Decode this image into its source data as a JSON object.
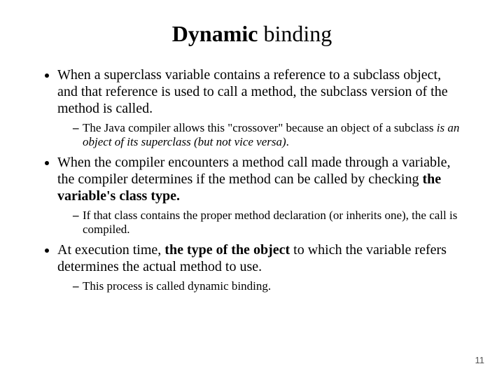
{
  "title": {
    "bold": "Dynamic",
    "rest": " binding"
  },
  "bullets": {
    "b1": "When a superclass variable contains a reference to a subclass object, and that reference is used to call a method, the subclass version of the method is called.",
    "b1_sub1_a": "The Java compiler allows this \"crossover\" because an object of a subclass ",
    "b1_sub1_b": "is an object of its superclass (but not vice versa)",
    "b1_sub1_c": ".",
    "b2_a": "When the compiler encounters a method call made through a variable, the compiler determines if the method can be called by checking ",
    "b2_b": "the variable's class type.",
    "b2_sub1": "If that class contains the proper method declaration (or inherits one), the call is compiled.",
    "b3_a": "At execution time, ",
    "b3_b": "the type of the object ",
    "b3_c": "to which the variable refers determines the actual method to use.",
    "b3_sub1": "This process is called dynamic binding."
  },
  "page_number": "11"
}
